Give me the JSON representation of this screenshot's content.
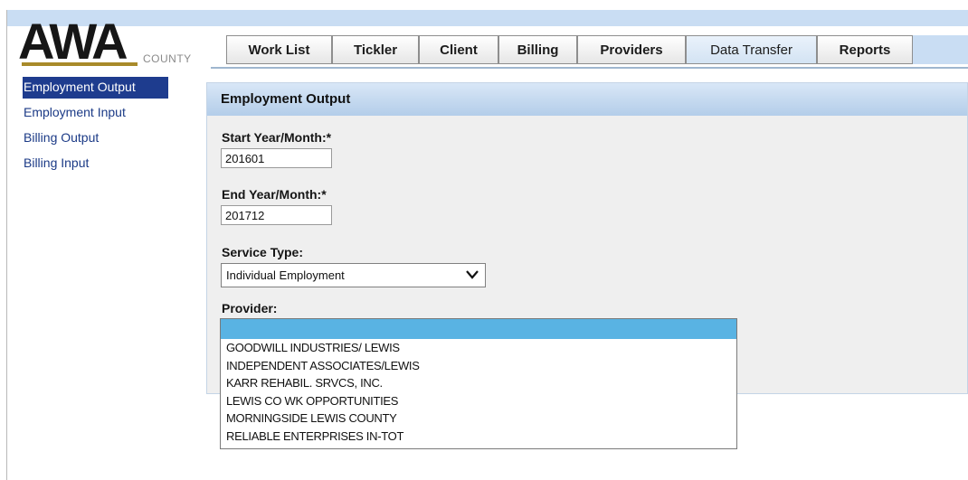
{
  "logo": {
    "main": "AWA",
    "sub": "COUNTY"
  },
  "tabs": [
    {
      "label": "Work List"
    },
    {
      "label": "Tickler"
    },
    {
      "label": "Client"
    },
    {
      "label": "Billing"
    },
    {
      "label": "Providers"
    },
    {
      "label": "Data Transfer"
    },
    {
      "label": "Reports"
    }
  ],
  "sidebar": {
    "items": [
      {
        "label": "Employment Output"
      },
      {
        "label": "Employment Input"
      },
      {
        "label": "Billing Output"
      },
      {
        "label": "Billing Input"
      }
    ]
  },
  "panel": {
    "title": "Employment Output",
    "start": {
      "label": "Start Year/Month:*",
      "value": "201601"
    },
    "end": {
      "label": "End Year/Month:*",
      "value": "201712"
    },
    "service": {
      "label": "Service Type:",
      "value": "Individual Employment"
    },
    "provider": {
      "label": "Provider:",
      "options": [
        "",
        "GOODWILL INDUSTRIES/ LEWIS",
        "INDEPENDENT ASSOCIATES/LEWIS",
        "KARR REHABIL. SRVCS, INC.",
        "LEWIS CO WK OPPORTUNITIES",
        "MORNINGSIDE LEWIS COUNTY",
        "RELIABLE ENTERPRISES IN-TOT"
      ]
    }
  },
  "colors": {
    "accent": "#1e3c8e",
    "highlight": "#59b3e3",
    "header": "#c9ddf3"
  }
}
